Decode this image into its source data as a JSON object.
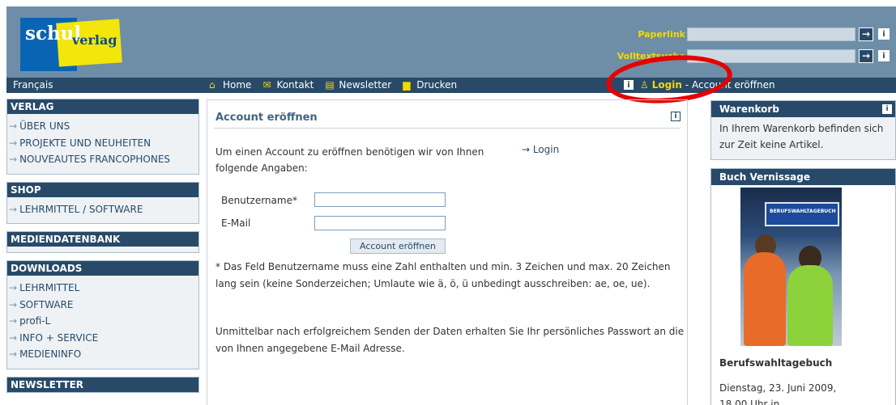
{
  "header": {
    "logo_schul": "schul",
    "logo_verlag": "verlag",
    "search1_label": "Paperlink",
    "search2_label": "Volltextsuche",
    "go_glyph": "→",
    "info_glyph": "i"
  },
  "navbar": {
    "language": "Français",
    "links": [
      "Home",
      "Kontakt",
      "Newsletter",
      "Drucken"
    ],
    "login": "Login",
    "account_text": "- Account eröffnen",
    "info_glyph": "i"
  },
  "sidebar": {
    "verlag": {
      "title": "VERLAG",
      "items": [
        "ÜBER UNS",
        "PROJEKTE UND NEUHEITEN",
        "NOUVEAUTES FRANCOPHONES"
      ]
    },
    "shop": {
      "title": "SHOP",
      "items": [
        "LEHRMITTEL / SOFTWARE"
      ]
    },
    "mediendatenbank": {
      "title": "MEDIENDATENBANK"
    },
    "downloads": {
      "title": "DOWNLOADS",
      "items": [
        "LEHRMITTEL",
        "SOFTWARE",
        "profi-L",
        "INFO + SERVICE",
        "MEDIENINFO"
      ]
    },
    "newsletter": {
      "title": "NEWSLETTER"
    },
    "arrow": "→"
  },
  "main": {
    "title": "Account eröffnen",
    "intro": "Um einen Account zu eröffnen benötigen wir von Ihnen folgende Angaben:",
    "login_link": "→ Login",
    "username_label": "Benutzername*",
    "email_label": "E-Mail",
    "submit_label": "Account eröffnen",
    "note": "* Das Feld Benutzername muss eine Zahl enthalten und min. 3 Zeichen und max. 20 Zeichen lang sein (keine Sonderzeichen; Umlaute wie ä, ö, ü unbedingt ausschreiben: ae, oe, ue).",
    "note2": "Unmittelbar nach erfolgreichem Senden der Daten erhalten Sie Ihr persönliches Passwort an die von Ihnen angegebene E-Mail Adresse."
  },
  "cart": {
    "title": "Warenkorb",
    "text": "In Ihrem Warenkorb befinden sich zur Zeit keine Artikel."
  },
  "event": {
    "title": "Buch Vernissage",
    "image_sign": "BERUFSWAHLTAGEBUCH",
    "book_title": "Berufswahltagebuch",
    "date": "Dienstag, 23. Juni 2009,",
    "date_cont": "18.00 Uhr in"
  },
  "colors": {
    "navy": "#284a68",
    "header_blue": "#6e8ea8",
    "yellow": "#f5d800",
    "annotation_red": "#e60000"
  }
}
